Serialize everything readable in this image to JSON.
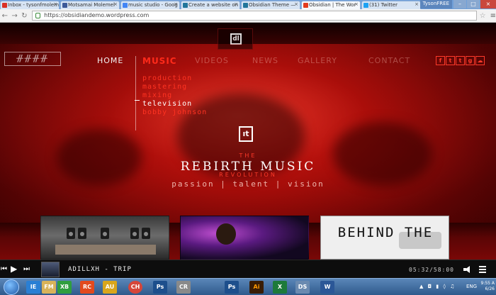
{
  "browser": {
    "tabs": [
      {
        "label": "Inbox - tysonfmolem",
        "favicon_color": "#d93025",
        "active": false
      },
      {
        "label": "Motsamai Molemel",
        "favicon_color": "#3b5998",
        "active": false
      },
      {
        "label": "music studio - Goog",
        "favicon_color": "#4285f4",
        "active": false
      },
      {
        "label": "Create a website on",
        "favicon_color": "#21759b",
        "active": false
      },
      {
        "label": "Obsidian Theme —",
        "favicon_color": "#21759b",
        "active": false
      },
      {
        "label": "Obsidian | The Wor",
        "favicon_color": "#e23b1d",
        "active": true
      },
      {
        "label": "(31) Twitter",
        "favicon_color": "#1da1f2",
        "active": false
      }
    ],
    "profile": "TysonFREE",
    "url": "https://obsidiandemo.wordpress.com"
  },
  "site": {
    "logo_text": "ᚌᚌᚌᚌ",
    "nav": {
      "home": "HOME",
      "music": "MUSIC",
      "videos": "VIDEOS",
      "news": "NEWS",
      "gallery": "GALLERY",
      "contact": "CONTACT"
    },
    "submenu": [
      "production",
      "mastering",
      "mixing",
      "television",
      "bobby johnson"
    ],
    "submenu_current": "television",
    "social": [
      "f",
      "t",
      "t",
      "g",
      "☁"
    ],
    "hero": {
      "the": "THE",
      "title": "REBIRTH MUSIC",
      "revolution": "REVOLUTION",
      "tagline": "passion | talent | vision"
    },
    "thumbnail_text": "BEHIND THE",
    "accent": "#ff2a1a"
  },
  "player": {
    "track": "ADILLXH - TRIP",
    "time": "05:32/58:00"
  },
  "taskbar": {
    "apps": [
      "IE",
      "FM",
      "XB",
      "RC",
      "AU",
      "CH",
      "Ps",
      "CR",
      "Ps",
      "Ai",
      "X",
      "DS",
      "W"
    ],
    "language": "ENG",
    "clock": "9:55 A\n6/26"
  }
}
